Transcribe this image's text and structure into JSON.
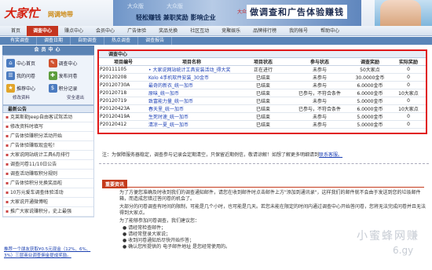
{
  "header": {
    "logo": "大家忙",
    "logo_sub": "网调地带",
    "banner_t1": "大众版",
    "banner_t2": "大众版",
    "banner_t3": "轻松赚钱 兼职奖励 影响企业",
    "banner_small": "大众",
    "banner_big": "做调查和广告体验赚钱"
  },
  "nav": [
    "首页",
    "调查中心",
    "赚点中心",
    "会员中心",
    "广告体验",
    "奖品兑换",
    "社区互动",
    "竞聚娱乐",
    "品牌排行榜",
    "我的帐号",
    "帮助中心"
  ],
  "nav_active": 1,
  "subnav": [
    "有奖调查",
    "调查日期",
    "自助调查",
    "热点调查",
    "调查报告"
  ],
  "sidebar": {
    "title": "会员中心",
    "items": [
      {
        "label": "中心首页",
        "icon": "home-icon",
        "color": "b"
      },
      {
        "label": "调查中心",
        "icon": "survey-icon",
        "color": "r"
      },
      {
        "label": "我的问卷",
        "icon": "questionnaire-icon",
        "color": "b"
      },
      {
        "label": "发布问卷",
        "icon": "publish-icon",
        "color": "g"
      },
      {
        "label": "推荐中心",
        "icon": "recommend-icon",
        "color": "y"
      },
      {
        "label": "积分记录",
        "icon": "points-icon",
        "color": "b"
      }
    ],
    "link_a": "修改资料",
    "link_b": "安全退出",
    "news_title": "最新公告",
    "news": [
      "克莱斯勒Jeep自由客试驾活动",
      "修改资料时填写",
      "广告体验赚积分活动开始",
      "广告体验赚取现金啦！",
      "大家说网站统计工具6月排行",
      "调查问卷11/10日公告",
      "调查活动赚取积分规则",
      "广告体验积分兑换奖品啦",
      "10万元爱车调查体验活动",
      "大家说开通微博啦",
      "推广大家说赚积分，史上最强"
    ],
    "promo": "推荐一个朋友获取¥0.5元现金（12%、6%、3%）三层商业调查佣金提成奖励。"
  },
  "panel": {
    "title": "调查中心",
    "columns": [
      "项目编号",
      "项目名称",
      "项目状态",
      "参与状态",
      "调查奖励",
      "实际奖励"
    ],
    "rows": [
      [
        "P20111105",
        "• 大家说网站统计工具安装活动_得大奖",
        "正在进行",
        "未参与",
        "50大家点",
        "0"
      ],
      [
        "P20120208",
        "Kolo 4手机软件安装_30金币",
        "已结束",
        "未参与",
        "30.0000金币",
        "0"
      ],
      [
        "P20120730A",
        "最奇的新衣_统一加币",
        "已结束",
        "未参与",
        "6.0000金币",
        "0"
      ],
      [
        "P20120718",
        "原味_统一加币",
        "已结束",
        "已参与，不符合条件",
        "6.0000金币",
        "10大家点"
      ],
      [
        "P20120719",
        "致富能力量_统一加币",
        "已结束",
        "未参与",
        "5.0000金币",
        "0"
      ],
      [
        "P20120423A",
        "春天里_统一加币",
        "已结束",
        "已参与，不符合条件",
        "6.0000金币",
        "10大家点"
      ],
      [
        "P20120419A",
        "生死时速_统一加币",
        "已结束",
        "未参与",
        "5.0000金币",
        "0"
      ],
      [
        "P20120412",
        "清凉一夏_统一加币",
        "已结束",
        "未参与",
        "5.0000金币",
        "0"
      ]
    ]
  },
  "notice": {
    "text": "注：为保障服务器稳定，调查参与记录会定期清空，只保留近期例信，敬请谅解！如想了解更多明细请到",
    "link": "联系客服。"
  },
  "section": {
    "title": "重要资讯",
    "p1": "为了方便您准确及时收到我们的调查通知邮件，请您在收到邮件时点击邮件上方\"添加到通讯录\"，这样我们的邮件就不会由于发送到您的垃圾邮件箱，而造成您错过答问卷的机会了。",
    "p2": "大部分的问卷调查有时间的限制，可能是几个小时，也可能是几天。若您未能在限定的时间内通过调查中心开始答问卷，您将无法完成问卷并且无法得到大家点。",
    "p3": "为了能够参加问卷调查，我们建议您：",
    "bullets": [
      "请经常检查邮件；",
      "请经常登录大家说；",
      "收到问卷通知后尽快开始作答；",
      "确认您所提供的 电子邮件地址 是您经常使用的。"
    ]
  },
  "watermark": {
    "l1": "小蜜蜂网赚",
    "l2": "6.gy"
  }
}
